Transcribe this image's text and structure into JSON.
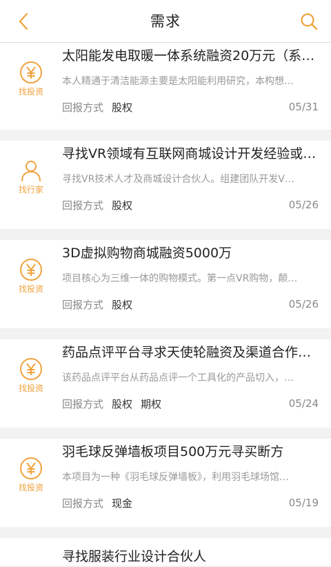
{
  "nav": {
    "title": "需求",
    "back_icon": "chevron-left-icon",
    "search_icon": "search-icon",
    "accent_color": "#f0a23c"
  },
  "items": [
    {
      "icon": "yen-coin-icon",
      "icon_label": "找投资",
      "title": "太阳能发电取暖一体系统融资20万元（系…",
      "desc": "本人精通于清洁能源主要是太阳能利用研究，本构想…",
      "meta_label": "回报方式",
      "tags": [
        "股权"
      ],
      "date": "05/31"
    },
    {
      "icon": "person-icon",
      "icon_label": "找行家",
      "title": "寻找VR领域有互联网商城设计开发经验或…",
      "desc": "寻找VR技术人才及商城设计合伙人。组建团队开发V…",
      "meta_label": "回报方式",
      "tags": [
        "股权"
      ],
      "date": "05/26"
    },
    {
      "icon": "yen-coin-icon",
      "icon_label": "找投资",
      "title": "3D虚拟购物商城融资5000万",
      "desc": "项目核心为三维一体的购物模式。第一点VR购物，颠…",
      "meta_label": "回报方式",
      "tags": [
        "股权"
      ],
      "date": "05/26"
    },
    {
      "icon": "yen-coin-icon",
      "icon_label": "找投资",
      "title": "药品点评平台寻求天使轮融资及渠道合作…",
      "desc": "该药品点评平台从药品点评一个工具化的产品切入，…",
      "meta_label": "回报方式",
      "tags": [
        "股权",
        "期权"
      ],
      "date": "05/24"
    },
    {
      "icon": "yen-coin-icon",
      "icon_label": "找投资",
      "title": "羽毛球反弹墙板项目500万元寻买断方",
      "desc": "本项目为一种《羽毛球反弹墙板》，利用羽毛球场馆…",
      "meta_label": "回报方式",
      "tags": [
        "现金"
      ],
      "date": "05/19"
    }
  ],
  "partial_item": {
    "title": "寻找服装行业设计合伙人"
  }
}
